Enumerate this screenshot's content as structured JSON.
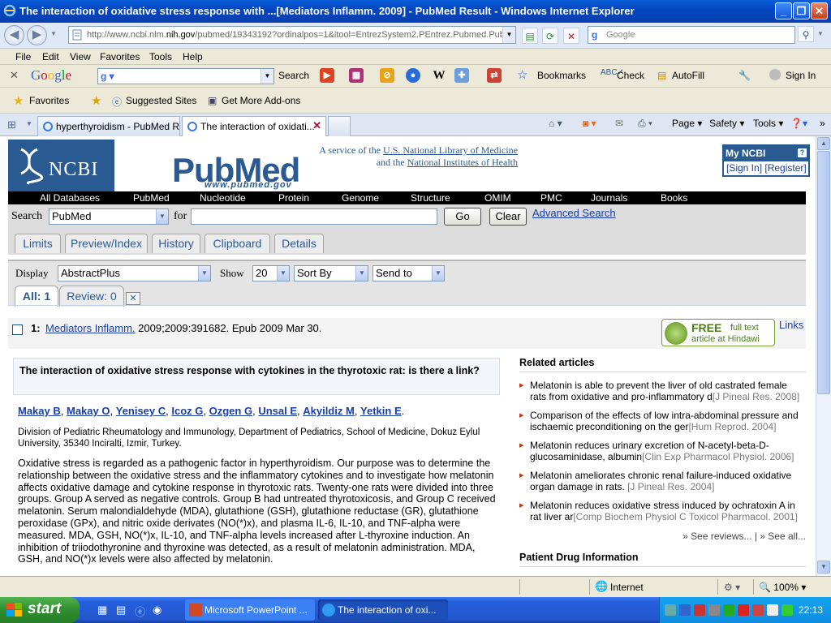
{
  "window": {
    "title": "The interaction of oxidative stress response with ...[Mediators Inflamm. 2009] - PubMed Result - Windows Internet Explorer"
  },
  "address_bar": {
    "url_prefix": "http://www.ncbi.nlm.",
    "url_domain": "nih.gov",
    "url_rest": "/pubmed/19343192?ordinalpos=1&itool=EntrezSystem2.PEntrez.Pubmed.Pub",
    "search_placeholder": "Google"
  },
  "menu": [
    "File",
    "Edit",
    "View",
    "Favorites",
    "Tools",
    "Help"
  ],
  "google_toolbar": {
    "logo": "Google",
    "search_label": "Search",
    "bookmarks": "Bookmarks",
    "check": "Check",
    "autofill": "AutoFill",
    "sign_in": "Sign In"
  },
  "favorites_bar": {
    "favorites": "Favorites",
    "suggested_sites": "Suggested Sites",
    "get_addons": "Get More Add-ons"
  },
  "tabs": [
    {
      "label": "hyperthyroidism - PubMed R..."
    },
    {
      "label": "The interaction of oxidati..."
    }
  ],
  "command_bar": {
    "page": "Page",
    "safety": "Safety",
    "tools": "Tools"
  },
  "ncbi": {
    "logo": "NCBI",
    "pubmed_logo": "PubMed",
    "pubmed_url": "www.pubmed.gov",
    "service_line1": "A service of the",
    "service_link1": "U.S. National Library of Medicine",
    "service_line2": "and the",
    "service_link2": "National Institutes of Health",
    "my_ncbi": "My NCBI",
    "help": "?",
    "sign_in": "[Sign In]",
    "register": "[Register]"
  },
  "databases": [
    "All Databases",
    "PubMed",
    "Nucleotide",
    "Protein",
    "Genome",
    "Structure",
    "OMIM",
    "PMC",
    "Journals",
    "Books"
  ],
  "search": {
    "label": "Search",
    "db_selected": "PubMed",
    "for_label": "for",
    "query": "",
    "go": "Go",
    "clear": "Clear",
    "advanced": "Advanced Search"
  },
  "page_tabs": [
    "Limits",
    "Preview/Index",
    "History",
    "Clipboard",
    "Details"
  ],
  "display": {
    "label": "Display",
    "format": "AbstractPlus",
    "show_label": "Show",
    "show_count": "20",
    "sort_by": "Sort By",
    "send_to": "Send to"
  },
  "subtabs": {
    "all": "All: 1",
    "review": "Review: 0"
  },
  "result": {
    "number": "1:",
    "journal": "Mediators Inflamm.",
    "citation": " 2009;2009:391682. Epub 2009 Mar 30.",
    "free_label": "FREE",
    "free_full_text": "full text",
    "free_sub": "article at Hindawi",
    "links": "Links"
  },
  "article": {
    "title": "The interaction of oxidative stress response with cytokines in the thyrotoxic rat: is there a link?",
    "authors": [
      "Makay B",
      "Makay O",
      "Yenisey C",
      "Icoz G",
      "Ozgen G",
      "Unsal E",
      "Akyildiz M",
      "Yetkin E"
    ],
    "affiliation": "Division of Pediatric Rheumatology and Immunology, Department of Pediatrics, School of Medicine, Dokuz Eylul University, 35340 Inciralti, Izmir, Turkey.",
    "abstract": "Oxidative stress is regarded as a pathogenic factor in hyperthyroidism. Our purpose was to determine the relationship between the oxidative stress and the inflammatory cytokines and to investigate how melatonin affects oxidative damage and cytokine response in thyrotoxic rats. Twenty-one rats were divided into three groups. Group A served as negative controls. Group B had untreated thyrotoxicosis, and Group C received melatonin. Serum malondialdehyde (MDA), glutathione (GSH), glutathione reductase (GR), glutathione peroxidase (GPx), and nitric oxide derivates (NO(*)x), and plasma IL-6, IL-10, and TNF-alpha were measured. MDA, GSH, NO(*)x, IL-10, and TNF-alpha levels increased after L-thyroxine induction. An inhibition of triiodothyronine and thyroxine was detected, as a result of melatonin administration. MDA, GSH, and NO(*)x levels were also affected by melatonin."
  },
  "related": {
    "heading": "Related articles",
    "items": [
      {
        "text": "Melatonin is able to prevent the liver of old castrated female rats from oxidative and pro-inflammatory d",
        "source": "[J Pineal Res. 2008]"
      },
      {
        "text": "Comparison of the effects of low intra-abdominal pressure and ischaemic preconditioning on the ger",
        "source": "[Hum Reprod. 2004]"
      },
      {
        "text": "Melatonin reduces urinary excretion of N-acetyl-beta-D-glucosaminidase, albumin",
        "source": "[Clin Exp Pharmacol Physiol. 2006]"
      },
      {
        "text": "Melatonin ameliorates chronic renal failure-induced oxidative organ damage in rats.",
        "source": "[J Pineal Res. 2004]"
      },
      {
        "text": "Melatonin reduces oxidative stress induced by ochratoxin A in rat liver ar",
        "source": "[Comp Biochem Physiol C Toxicol Pharmacol. 2001]"
      }
    ],
    "see_reviews": "» See reviews... | » See all...",
    "patient_drug": "Patient Drug Information"
  },
  "status_bar": {
    "zone": "Internet",
    "zoom": "100%"
  },
  "taskbar": {
    "start": "start",
    "items": [
      "Microsoft PowerPoint ...",
      "The interaction of oxi..."
    ],
    "clock": "22:13"
  }
}
